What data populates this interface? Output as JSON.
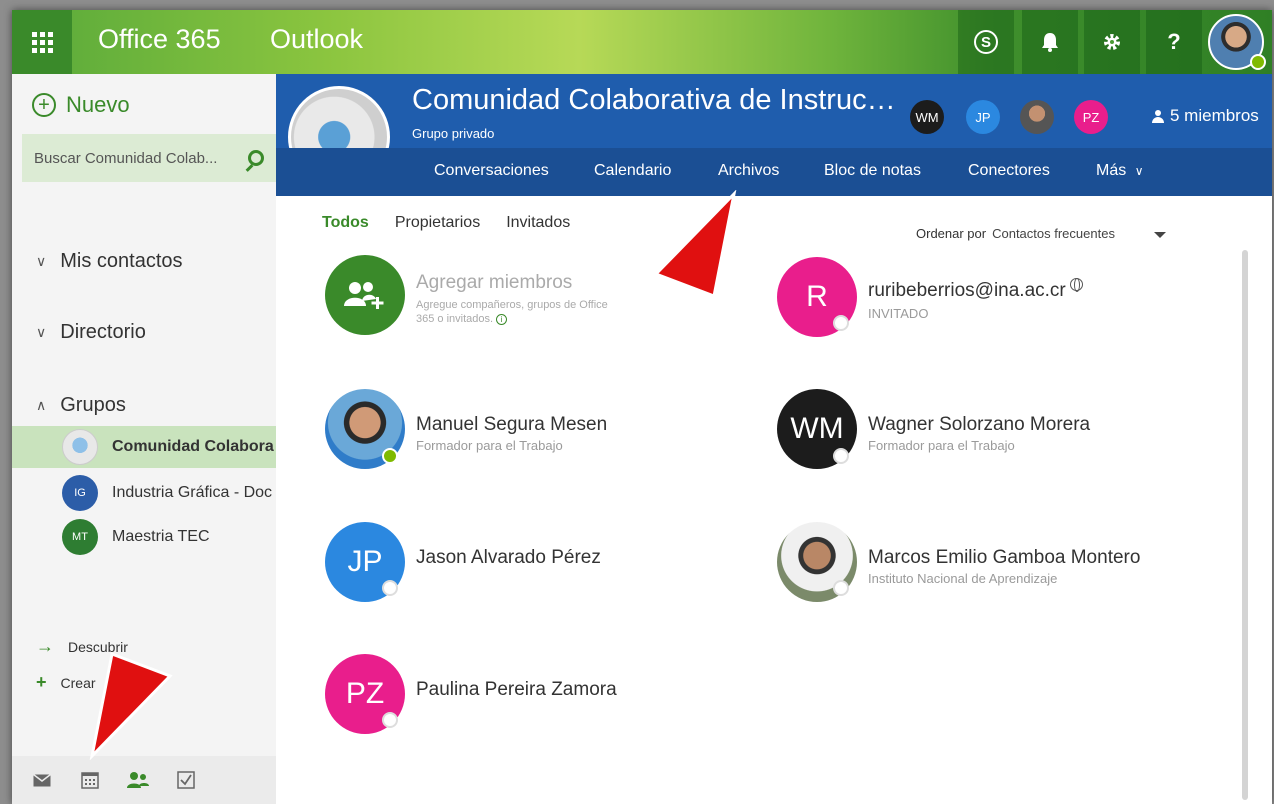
{
  "topbar": {
    "brand": "Office 365",
    "app": "Outlook",
    "icons": [
      "waffle-icon",
      "skype-icon",
      "bell-icon",
      "gear-icon",
      "help-icon"
    ],
    "skype_glyph": "S",
    "help_glyph": "?",
    "accent": "#3a8a2a"
  },
  "left": {
    "new_label": "Nuevo",
    "search_placeholder": "Buscar Comunidad Colab...",
    "sections": {
      "contacts": "Mis contactos",
      "directory": "Directorio",
      "groups": "Grupos"
    },
    "groups": [
      {
        "label": "Comunidad Colabora",
        "initials": ""
      },
      {
        "label": "Industria Gráfica - Doc",
        "initials": "IG"
      },
      {
        "label": "Maestria TEC",
        "initials": "MT"
      }
    ],
    "discover": "Descubrir",
    "create": "Crear",
    "bottom_icons": [
      "mail-icon",
      "calendar-icon",
      "people-icon",
      "tasks-icon"
    ]
  },
  "group": {
    "title": "Comunidad Colaborativa de Instruc…",
    "subtitle": "Grupo privado",
    "header_avatars": [
      "WM",
      "JP",
      "",
      "PZ"
    ],
    "members_label": "5 miembros",
    "tabs": [
      "Conversaciones",
      "Calendario",
      "Archivos",
      "Bloc de notas",
      "Conectores",
      "Más"
    ],
    "header_color": "#1f5dad"
  },
  "content": {
    "filters": [
      "Todos",
      "Propietarios",
      "Invitados"
    ],
    "sort_label": "Ordenar por",
    "sort_value": "Contactos frecuentes",
    "add": {
      "title": "Agregar miembros",
      "hint": "Agregue compañeros, grupos de Office 365 o invitados."
    },
    "members": [
      {
        "initials": "R",
        "name": "ruribeberrios@ina.ac.cr",
        "sub": "INVITADO",
        "color": "#e91e8c"
      },
      {
        "initials": "",
        "name": "Manuel Segura Mesen",
        "sub": "Formador para el Trabajo"
      },
      {
        "initials": "WM",
        "name": "Wagner Solorzano Morera",
        "sub": "Formador para el Trabajo",
        "color": "#1c1c1c"
      },
      {
        "initials": "JP",
        "name": "Jason Alvarado Pérez",
        "sub": "",
        "color": "#2b88e0"
      },
      {
        "initials": "",
        "name": "Marcos Emilio Gamboa Montero",
        "sub": "Instituto Nacional de Aprendizaje"
      },
      {
        "initials": "PZ",
        "name": "Paulina Pereira Zamora",
        "sub": "",
        "color": "#e91e8c"
      }
    ]
  }
}
